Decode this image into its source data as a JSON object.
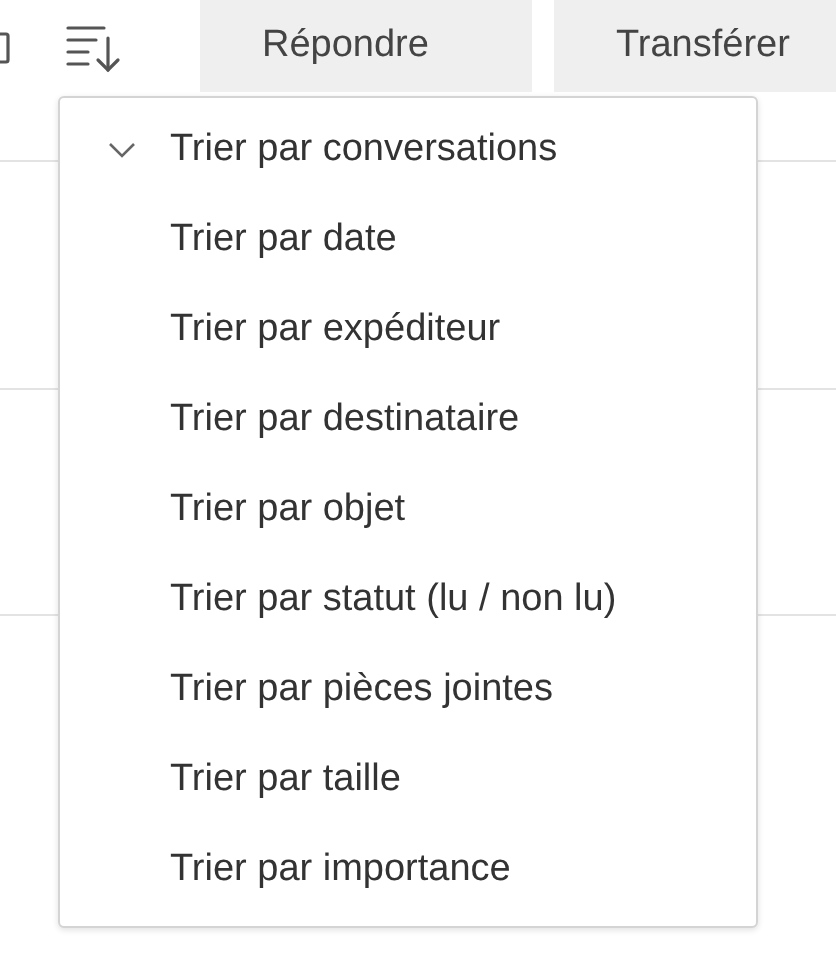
{
  "toolbar": {
    "buttons": [
      {
        "label": "Répondre"
      },
      {
        "label": "Transférer"
      }
    ]
  },
  "sort_menu": {
    "items": [
      {
        "label": "Trier par conversations",
        "checked": true
      },
      {
        "label": "Trier par date",
        "checked": false
      },
      {
        "label": "Trier par expéditeur",
        "checked": false
      },
      {
        "label": "Trier par destinataire",
        "checked": false
      },
      {
        "label": "Trier par objet",
        "checked": false
      },
      {
        "label": "Trier par statut (lu / non lu)",
        "checked": false
      },
      {
        "label": "Trier par pièces jointes",
        "checked": false
      },
      {
        "label": "Trier par taille",
        "checked": false
      },
      {
        "label": "Trier par importance",
        "checked": false
      }
    ]
  }
}
